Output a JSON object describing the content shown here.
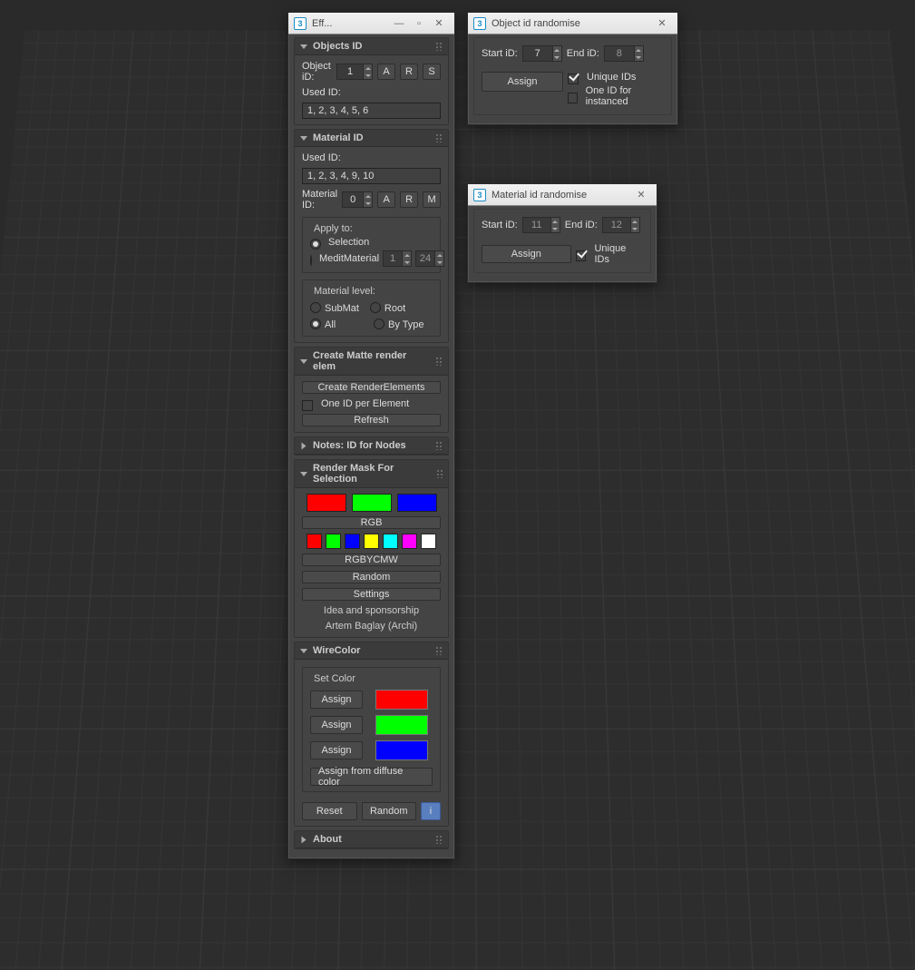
{
  "mainWindow": {
    "title": "Eff...",
    "sections": {
      "objectsID": {
        "title": "Objects ID",
        "objlabel": "Object iD:",
        "objVal": "1",
        "btnA": "A",
        "btnR": "R",
        "btnS": "S",
        "usedLabel": "Used ID:",
        "usedVal": "1, 2, 3, 4, 5, 6"
      },
      "materialID": {
        "title": "Material ID",
        "usedLabel": "Used ID:",
        "usedVal": "1, 2, 3, 4, 9, 10",
        "matLabel": "Material ID:",
        "matVal": "0",
        "btnA": "A",
        "btnR": "R",
        "btnM": "M",
        "applyTitle": "Apply to:",
        "applySelection": "Selection",
        "applyMeditMaterial": "MeditMaterial",
        "mmVal1": "1",
        "mmVal2": "24",
        "levelTitle": "Material level:",
        "lvlSubMat": "SubMat",
        "lvlRoot": "Root",
        "lvlAll": "All",
        "lvlByType": "By Type"
      },
      "matte": {
        "title": "Create Matte render elem",
        "create": "Create RenderElements",
        "oneId": "One ID per Element",
        "refresh": "Refresh"
      },
      "notes": {
        "title": "Notes: ID for Nodes"
      },
      "renderMask": {
        "title": "Render Mask For Selection",
        "rgb": "RGB",
        "rgbycmw": "RGBYCMW",
        "random": "Random",
        "settings": "Settings",
        "credit1": "Idea and sponsorship",
        "credit2": "Artem Baglay (Archi)",
        "big": [
          {
            "color": "#ff0000"
          },
          {
            "color": "#00ff00"
          },
          {
            "color": "#0000ff"
          }
        ],
        "small": [
          {
            "color": "#ff0000"
          },
          {
            "color": "#00ff00"
          },
          {
            "color": "#0000ff"
          },
          {
            "color": "#ffff00"
          },
          {
            "color": "#00ffff"
          },
          {
            "color": "#ff00ff"
          },
          {
            "color": "#ffffff"
          }
        ]
      },
      "wirecolor": {
        "title": "WireColor",
        "setColor": "Set Color",
        "assign": "Assign",
        "assignDiffuse": "Assign from diffuse color",
        "colors": [
          "#ff0000",
          "#00ff00",
          "#0000ff"
        ],
        "reset": "Reset",
        "random": "Random",
        "info": "i"
      },
      "about": {
        "title": "About"
      }
    }
  },
  "objRandom": {
    "title": "Object id randomise",
    "startLabel": "Start iD:",
    "startVal": "7",
    "endLabel": "End iD:",
    "endVal": "8",
    "assign": "Assign",
    "uniqueIds": "Unique IDs",
    "oneForInstanced": "One ID for instanced"
  },
  "matRandom": {
    "title": "Material id randomise",
    "startLabel": "Start iD:",
    "startVal": "11",
    "endLabel": "End iD:",
    "endVal": "12",
    "assign": "Assign",
    "uniqueIds": "Unique IDs"
  }
}
